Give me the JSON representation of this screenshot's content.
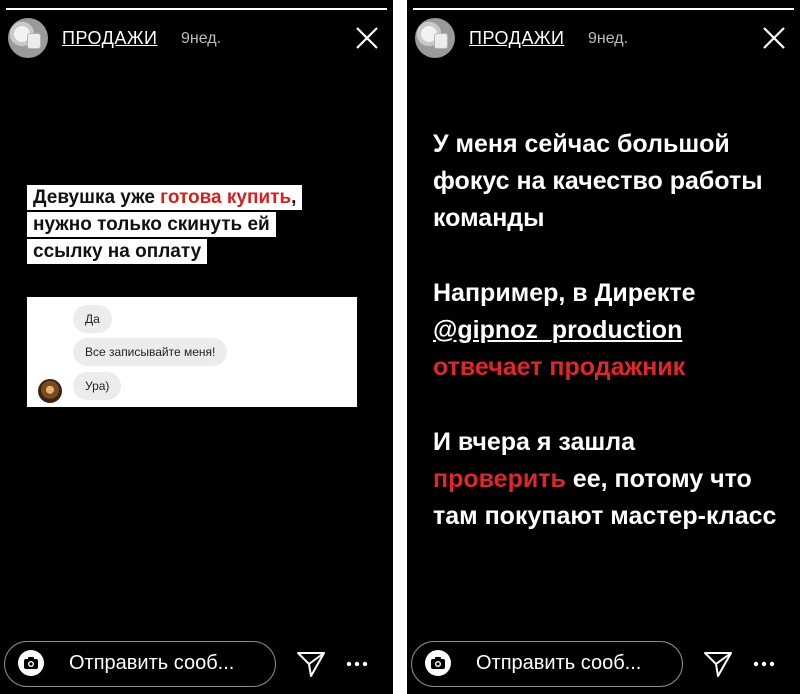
{
  "stories": [
    {
      "username": "ПРОДАЖИ",
      "time": "9нед.",
      "caption": {
        "line1_plain": "Девушка уже ",
        "line1_red": "готова купить",
        "line1_end": ",",
        "line2": "нужно только скинуть ей",
        "line3": "ссылку на оплату"
      },
      "chat": {
        "msg1": "Да",
        "msg2": "Все записывайте меня!",
        "msg3": "Ура)"
      },
      "reply_placeholder": "Отправить сооб...",
      "progress": 1.0
    },
    {
      "username": "ПРОДАЖИ",
      "time": "9нед.",
      "text": {
        "p1": "У меня сейчас большой фокус на качество работы команды",
        "p2_pre": "Например, в Директе",
        "p2_handle": "@gipnoz_production",
        "p2_red": "отвечает продажник",
        "p3_pre": "И вчера я зашла",
        "p3_red": "проверить",
        "p3_post": " ее, потому что там покупают мастер-класс"
      },
      "reply_placeholder": "Отправить сооб...",
      "progress": 1.0
    }
  ],
  "icons": {
    "close": "close-icon",
    "camera": "camera-icon",
    "send": "paper-plane-icon",
    "more": "more-dots-icon"
  },
  "colors": {
    "background": "#000000",
    "accent_red": "#e0262a",
    "text": "#ffffff"
  }
}
